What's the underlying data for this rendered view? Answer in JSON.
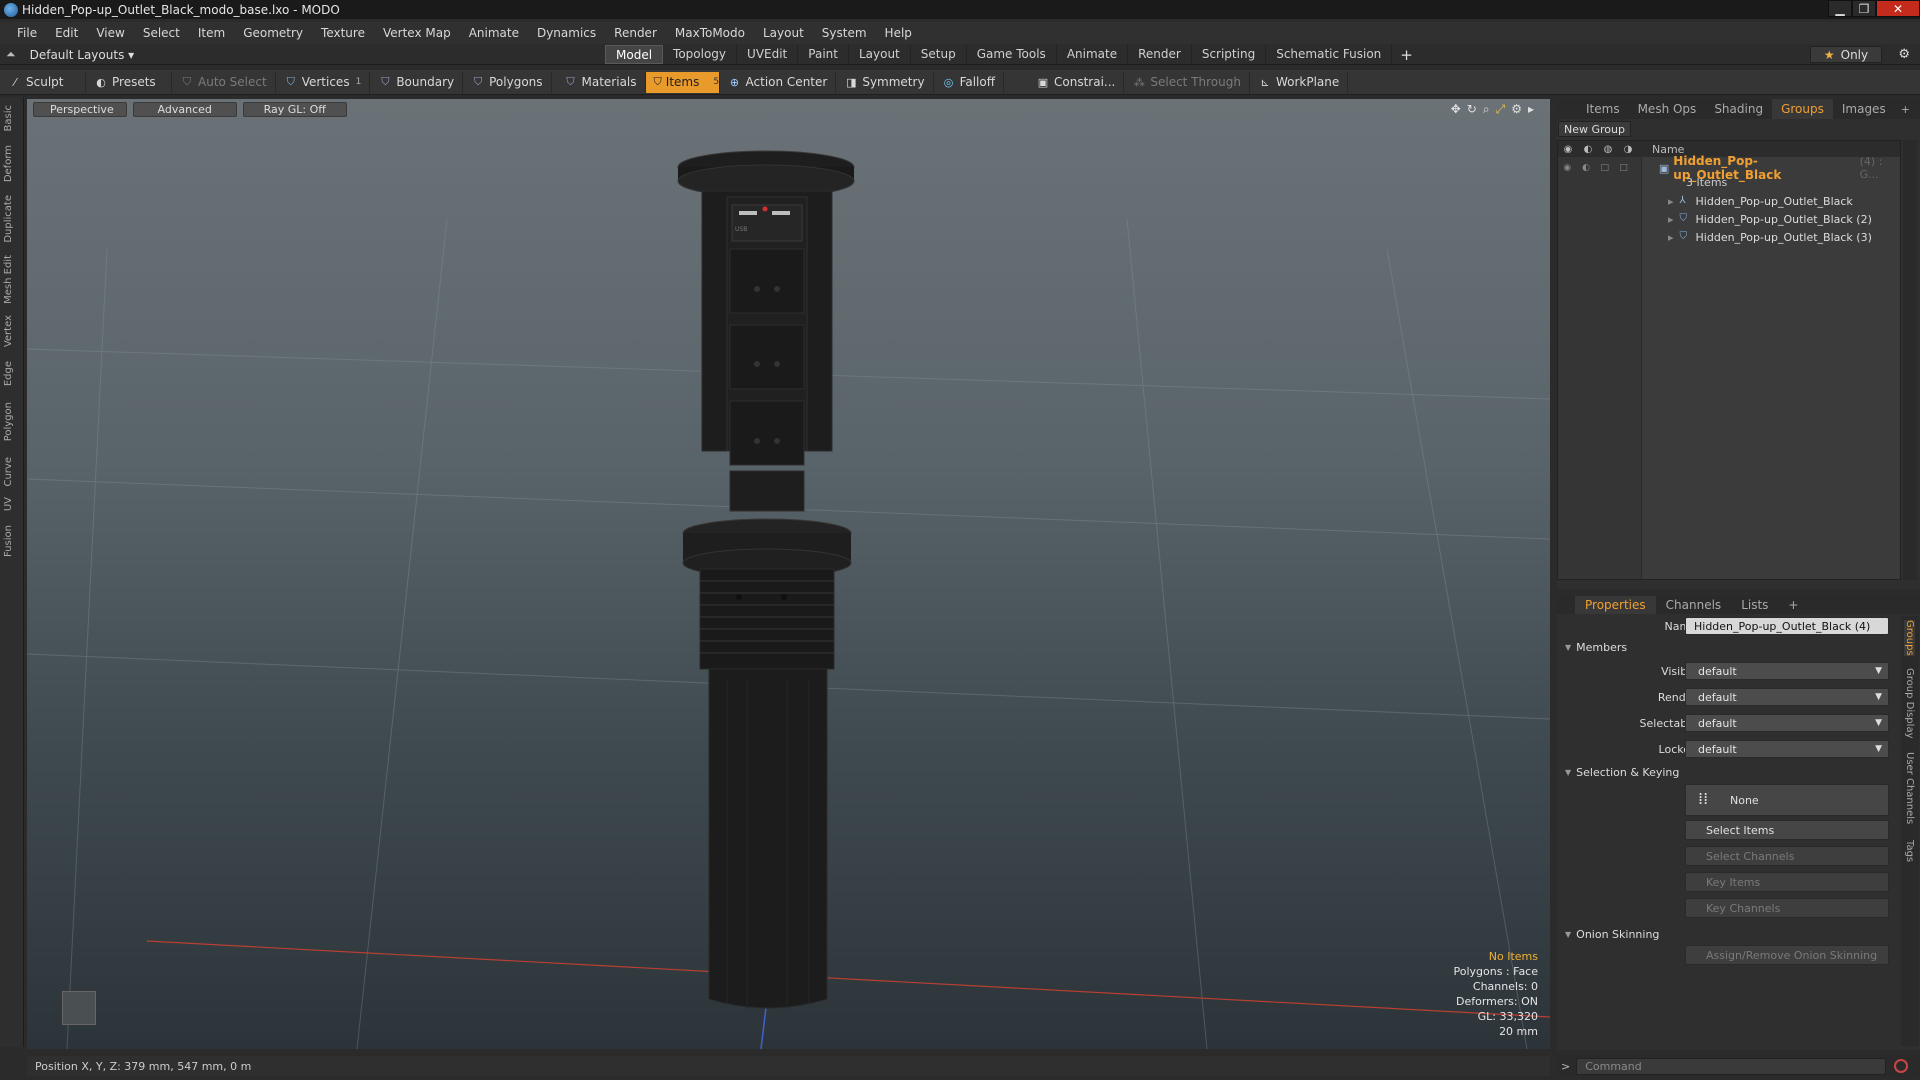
{
  "window": {
    "title": "Hidden_Pop-up_Outlet_Black_modo_base.lxo - MODO",
    "minimize": "▁",
    "maximize": "❐",
    "close": "✕"
  },
  "menu": [
    "File",
    "Edit",
    "View",
    "Select",
    "Item",
    "Geometry",
    "Texture",
    "Vertex Map",
    "Animate",
    "Dynamics",
    "Render",
    "MaxToModo",
    "Layout",
    "System",
    "Help"
  ],
  "layout_selector": "Default Layouts ▾",
  "modes": [
    "Model",
    "Topology",
    "UVEdit",
    "Paint",
    "Layout",
    "Setup",
    "Game Tools",
    "Animate",
    "Render",
    "Scripting",
    "Schematic Fusion"
  ],
  "active_mode": "Model",
  "mode_add": "+",
  "only_label": "Only",
  "toolbar": {
    "sculpt": "Sculpt",
    "presets": "Presets",
    "auto_select": "Auto Select",
    "vertices": "Vertices",
    "vertices_num": "1",
    "boundary": "Boundary",
    "polygons": "Polygons",
    "materials": "Materials",
    "items": "Items",
    "items_num": "5",
    "action_center": "Action Center",
    "symmetry": "Symmetry",
    "falloff": "Falloff",
    "constraints": "Constrai...",
    "select_through": "Select Through",
    "workplane": "WorkPlane"
  },
  "left_tabs": [
    "Basic",
    "Deform",
    "Duplicate",
    "Mesh Edit",
    "Vertex",
    "Edge",
    "Polygon",
    "Curve",
    "UV",
    "Fusion"
  ],
  "viewport": {
    "view_mode": "Perspective",
    "shading": "Advanced",
    "raygl": "Ray GL: Off",
    "info": {
      "selection": "No Items",
      "polygons": "Polygons : Face",
      "channels": "Channels: 0",
      "deformers": "Deformers: ON",
      "gl": "GL: 33,320",
      "scale": "20 mm"
    },
    "usb_label": "USB"
  },
  "status": {
    "position": "Position X, Y, Z:  379 mm, 547 mm, 0 m"
  },
  "groups_panel": {
    "tabs": [
      "Items",
      "Mesh Ops",
      "Shading",
      "Groups",
      "Images"
    ],
    "active_tab": "Groups",
    "new_group": "New Group",
    "name_header": "Name",
    "group": {
      "name": "Hidden_Pop-up_Outlet_Black",
      "count": "(4) : G...",
      "items_label": "3 Items"
    },
    "children": [
      "Hidden_Pop-up_Outlet_Black",
      "Hidden_Pop-up_Outlet_Black (2)",
      "Hidden_Pop-up_Outlet_Black (3)"
    ]
  },
  "properties": {
    "tabs": [
      "Properties",
      "Channels",
      "Lists"
    ],
    "active_tab": "Properties",
    "name_label": "Name",
    "name_value": "Hidden_Pop-up_Outlet_Black (4)",
    "members_section": "Members",
    "visible_label": "Visible",
    "visible_value": "default",
    "render_label": "Render",
    "render_value": "default",
    "selectable_label": "Selectable",
    "selectable_value": "default",
    "locked_label": "Locked",
    "locked_value": "default",
    "selkey_section": "Selection & Keying",
    "none_btn": "None",
    "select_items": "Select Items",
    "select_channels": "Select Channels",
    "key_items": "Key Items",
    "key_channels": "Key Channels",
    "onion_section": "Onion Skinning",
    "onion_btn": "Assign/Remove Onion Skinning",
    "side_tabs": [
      "Groups",
      "Group Display",
      "User Channels",
      "Tags"
    ]
  },
  "command": {
    "placeholder": "Command",
    "caret": ">"
  },
  "colors": {
    "accent": "#f0a030",
    "active_tool": "#e89a2a"
  }
}
